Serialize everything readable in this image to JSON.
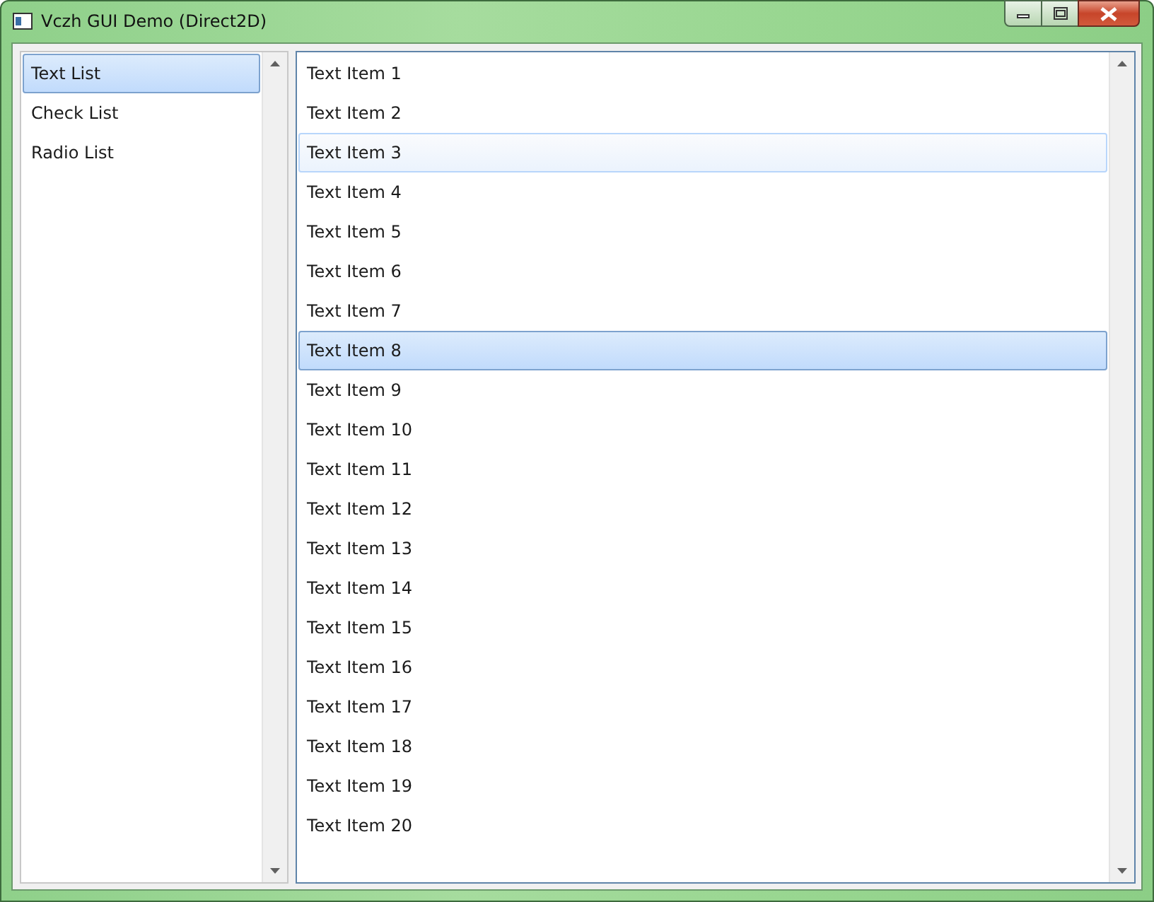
{
  "window": {
    "title": "Vczh GUI Demo (Direct2D)"
  },
  "sidebar": {
    "items": [
      {
        "label": "Text List",
        "selected": true
      },
      {
        "label": "Check List",
        "selected": false
      },
      {
        "label": "Radio List",
        "selected": false
      }
    ]
  },
  "list": {
    "items": [
      {
        "label": "Text Item 1",
        "selected": false,
        "hovered": false
      },
      {
        "label": "Text Item 2",
        "selected": false,
        "hovered": false
      },
      {
        "label": "Text Item 3",
        "selected": false,
        "hovered": true
      },
      {
        "label": "Text Item 4",
        "selected": false,
        "hovered": false
      },
      {
        "label": "Text Item 5",
        "selected": false,
        "hovered": false
      },
      {
        "label": "Text Item 6",
        "selected": false,
        "hovered": false
      },
      {
        "label": "Text Item 7",
        "selected": false,
        "hovered": false
      },
      {
        "label": "Text Item 8",
        "selected": true,
        "hovered": false
      },
      {
        "label": "Text Item 9",
        "selected": false,
        "hovered": false
      },
      {
        "label": "Text Item 10",
        "selected": false,
        "hovered": false
      },
      {
        "label": "Text Item 11",
        "selected": false,
        "hovered": false
      },
      {
        "label": "Text Item 12",
        "selected": false,
        "hovered": false
      },
      {
        "label": "Text Item 13",
        "selected": false,
        "hovered": false
      },
      {
        "label": "Text Item 14",
        "selected": false,
        "hovered": false
      },
      {
        "label": "Text Item 15",
        "selected": false,
        "hovered": false
      },
      {
        "label": "Text Item 16",
        "selected": false,
        "hovered": false
      },
      {
        "label": "Text Item 17",
        "selected": false,
        "hovered": false
      },
      {
        "label": "Text Item 18",
        "selected": false,
        "hovered": false
      },
      {
        "label": "Text Item 19",
        "selected": false,
        "hovered": false
      },
      {
        "label": "Text Item 20",
        "selected": false,
        "hovered": false
      }
    ]
  }
}
